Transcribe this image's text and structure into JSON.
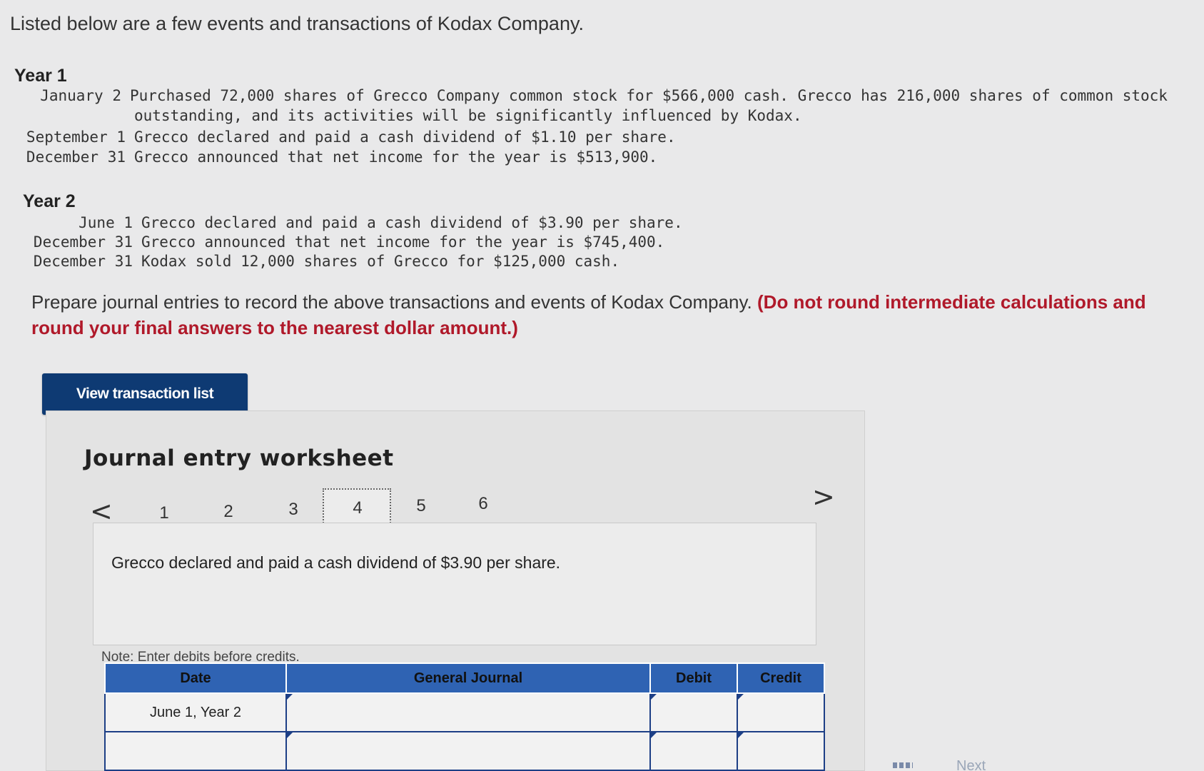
{
  "intro": "Listed below are a few events and transactions of Kodax Company.",
  "year1": {
    "heading": "Year 1",
    "events": [
      {
        "date": "January 2",
        "text": "Purchased 72,000 shares of Grecco Company common stock for $566,000 cash. Grecco has 216,000 shares of common stock",
        "cont": "outstanding, and its activities will be significantly influenced by Kodax."
      },
      {
        "date": "September 1",
        "text": "Grecco declared and paid a cash dividend of $1.10 per share."
      },
      {
        "date": "December 31",
        "text": "Grecco announced that net income for the year is $513,900."
      }
    ]
  },
  "year2": {
    "heading": "Year 2",
    "events": [
      {
        "date": "June 1",
        "text": "Grecco declared and paid a cash dividend of $3.90 per share."
      },
      {
        "date": "December 31",
        "text": "Grecco announced that net income for the year is $745,400."
      },
      {
        "date": "December 31",
        "text": "Kodax sold 12,000 shares of Grecco for $125,000 cash."
      }
    ]
  },
  "instructions": {
    "main": "Prepare journal entries to record the above transactions and events of Kodax Company.",
    "note_red": "(Do not round intermediate calculations and round your final answers to the nearest dollar amount.)"
  },
  "view_button": "View transaction list",
  "worksheet": {
    "title": "Journal entry worksheet",
    "prev_arrow": "<",
    "next_arrow": ">",
    "pages": [
      "1",
      "2",
      "3",
      "4",
      "5",
      "6"
    ],
    "active_page": "4",
    "description": "Grecco declared and paid a cash dividend of $3.90 per share.",
    "note": "Note: Enter debits before credits.",
    "table": {
      "headers": {
        "date": "Date",
        "journal": "General Journal",
        "debit": "Debit",
        "credit": "Credit"
      },
      "rows": [
        {
          "date": "June 1, Year 2",
          "journal": "",
          "debit": "",
          "credit": ""
        },
        {
          "date": "",
          "journal": "",
          "debit": "",
          "credit": ""
        }
      ]
    }
  },
  "footer": {
    "next_label": "Next"
  },
  "colors": {
    "button_bg": "#0e3a73",
    "header_bg": "#2f63b3",
    "accent_red": "#b0192a"
  }
}
